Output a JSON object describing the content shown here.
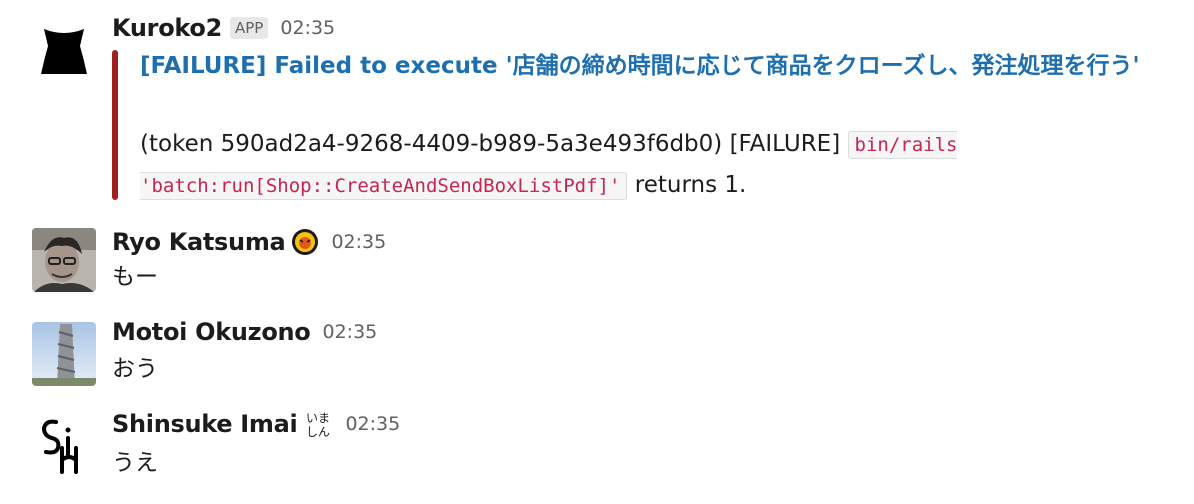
{
  "messages": [
    {
      "sender": "Kuroko2",
      "badge": "APP",
      "time": "02:35",
      "attachment": {
        "title": "[FAILURE] Failed to execute '店舗の締め時間に応じて商品をクローズし、発注処理を行う'",
        "text_before": "(token 590ad2a4-9268-4409-b989-5a3e493f6db0) [FAILURE] ",
        "code_command": "bin/rails 'batch:run[Shop::CreateAndSendBoxListPdf]'",
        "text_after": " returns 1.",
        "color": "#a02020"
      }
    },
    {
      "sender": "Ryo Katsuma",
      "time": "02:35",
      "text": "もー",
      "status_icon": "tigers-badge-icon"
    },
    {
      "sender": "Motoi Okuzono",
      "time": "02:35",
      "text": "おう"
    },
    {
      "sender": "Shinsuke Imai",
      "time": "02:35",
      "text": "うえ",
      "status_icon": "imashin-icon",
      "status_icon_text": "いましん"
    }
  ],
  "colors": {
    "link": "#1d6fb0",
    "code": "#c7254e",
    "failure_bar": "#a02020",
    "muted": "#616061"
  }
}
